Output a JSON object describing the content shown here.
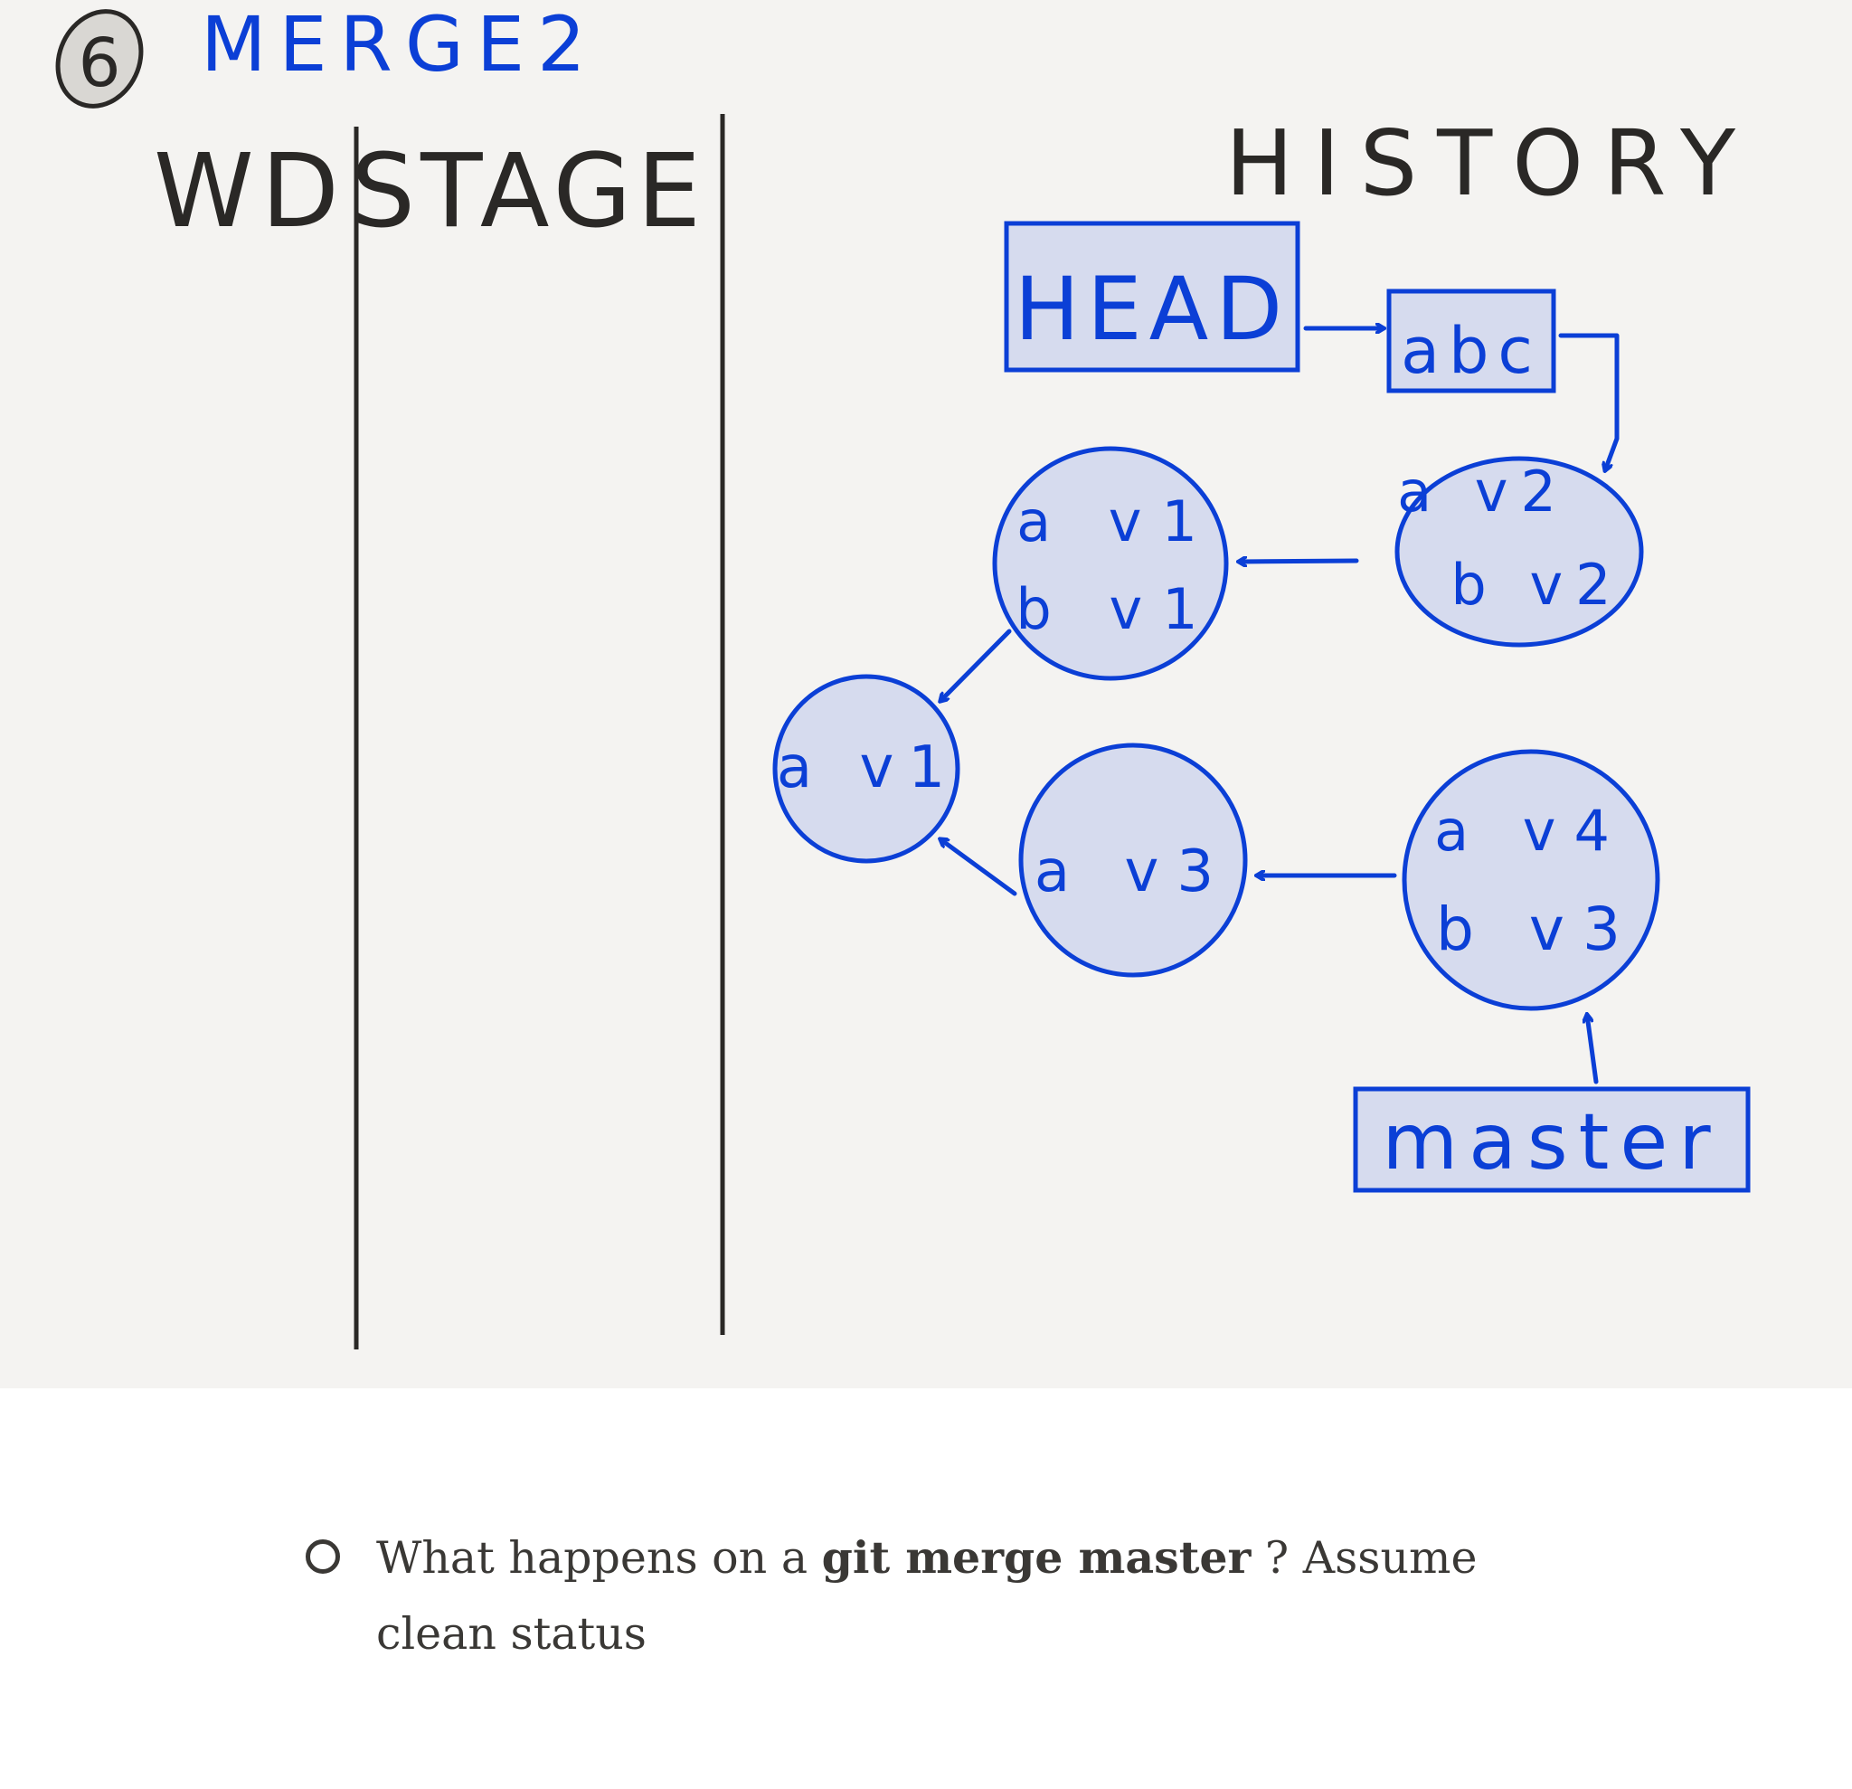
{
  "diagram": {
    "step_number": "6",
    "title": "MERGE2",
    "columns": {
      "wd": "WD",
      "stage": "STAGE",
      "history": "HISTORY"
    },
    "refs": {
      "head": "HEAD",
      "master": "master"
    },
    "commits": {
      "abc": "abc",
      "left_root": {
        "line1": "a v1"
      },
      "upper_left": {
        "line1": "a v1",
        "line2": "b v1"
      },
      "upper_right": {
        "line1": "a v2",
        "line2": "b v2"
      },
      "lower_left": {
        "line1": "a v3"
      },
      "lower_right": {
        "line1": "a v4",
        "line2": "b v3"
      }
    },
    "colors": {
      "ink": "#2a2826",
      "blue": "#0b3fd6",
      "node_fill": "#d6dbee",
      "canvas": "#f4f3f1"
    }
  },
  "question": {
    "prefix": "What happens on a",
    "command": "git merge master",
    "suffix": "? Assume clean status"
  }
}
